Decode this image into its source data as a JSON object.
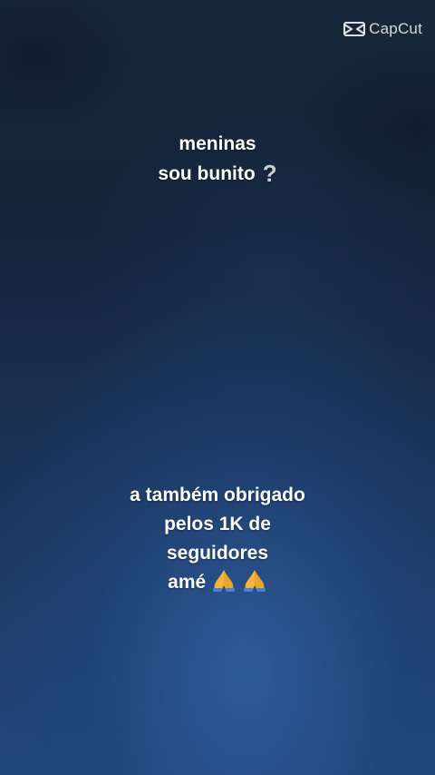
{
  "watermark": {
    "label": "CapCut",
    "icon": "capcut-logo-icon"
  },
  "caption_top": {
    "line1": "meninas",
    "line2": "sou bunito",
    "emoji": "question-mark-icon"
  },
  "caption_bottom": {
    "line1": "a também obrigado",
    "line2": "pelos 1K de",
    "line3": "seguidores",
    "line4": "amé",
    "emoji": "folded-hands-icon"
  },
  "colors": {
    "background_dark": "#15243a",
    "background_light": "#23467a",
    "text": "#ffffff",
    "emoji_hands": "#f2b53a"
  }
}
